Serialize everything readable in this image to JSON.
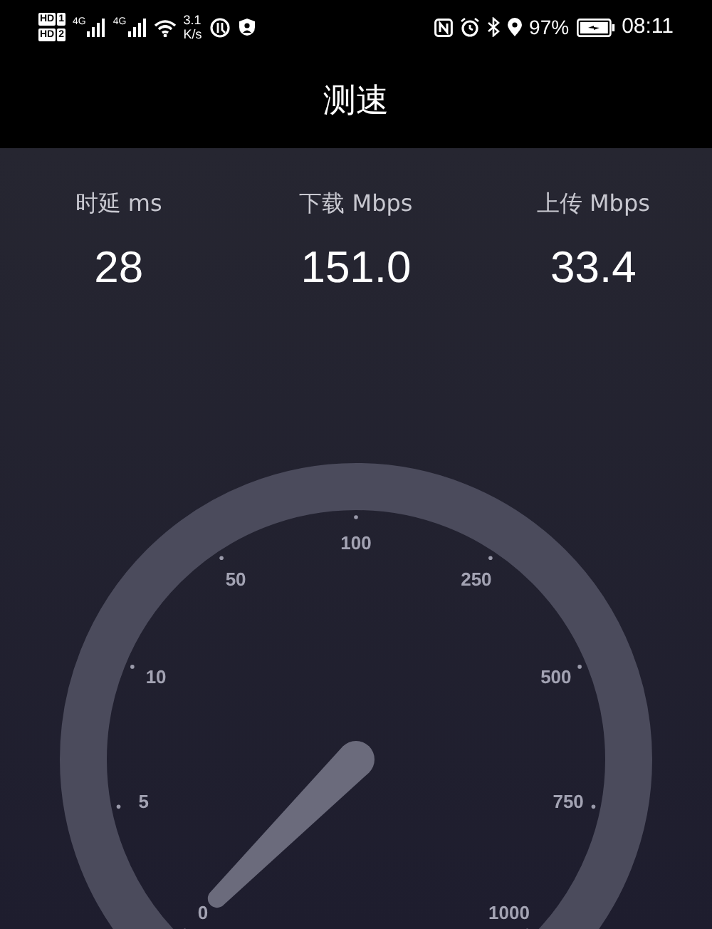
{
  "status_bar": {
    "sims": [
      {
        "tech": "HD",
        "slot": "1"
      },
      {
        "tech": "HD",
        "slot": "2"
      }
    ],
    "signals": [
      {
        "network": "4G"
      },
      {
        "network": "4G"
      }
    ],
    "speed_value": "3.1",
    "speed_unit": "K/s",
    "battery": "97%",
    "charging": true,
    "time": "08:11"
  },
  "title": "测速",
  "metrics": [
    {
      "label": "时延 ms",
      "value": "28"
    },
    {
      "label": "下载 Mbps",
      "value": "151.0"
    },
    {
      "label": "上传 Mbps",
      "value": "33.4"
    }
  ],
  "gauge": {
    "ticks": [
      "0",
      "5",
      "10",
      "50",
      "100",
      "250",
      "500",
      "750",
      "1000"
    ]
  }
}
